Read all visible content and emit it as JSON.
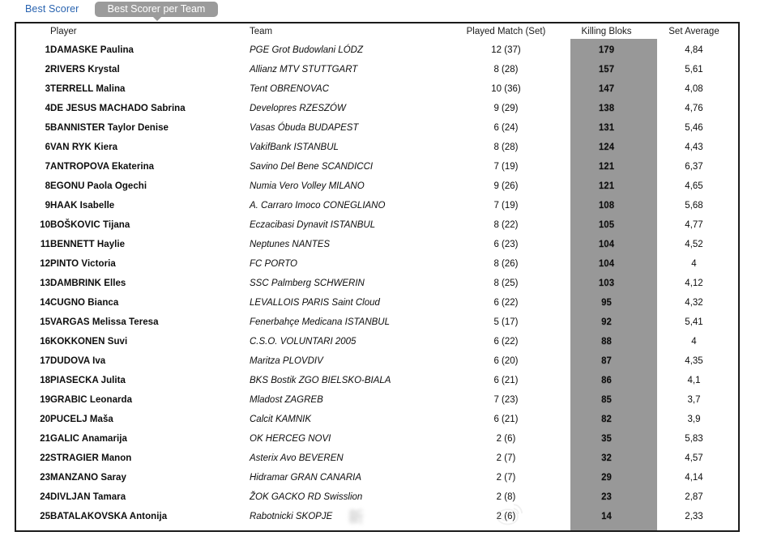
{
  "tabs": {
    "inactive_label": "Best Scorer",
    "active_label": "Best Scorer per Team"
  },
  "table": {
    "headers": {
      "rank": "",
      "player": "Player",
      "team": "Team",
      "played": "Played Match (Set)",
      "killing_blocks": "Killing Bloks",
      "set_average": "Set Average"
    },
    "highlight_color": "#989898",
    "rows": [
      {
        "rank": "1",
        "player": "DAMASKE Paulina",
        "team": "PGE Grot Budowlani LÓDZ",
        "played": "12 (37)",
        "kb": "179",
        "avg": "4,84"
      },
      {
        "rank": "2",
        "player": "RIVERS Krystal",
        "team": "Allianz MTV STUTTGART",
        "played": "8 (28)",
        "kb": "157",
        "avg": "5,61"
      },
      {
        "rank": "3",
        "player": "TERRELL Malina",
        "team": "Tent OBRENOVAC",
        "played": "10 (36)",
        "kb": "147",
        "avg": "4,08"
      },
      {
        "rank": "4",
        "player": "DE JESUS MACHADO Sabrina",
        "team": "Developres RZESZÓW",
        "played": "9 (29)",
        "kb": "138",
        "avg": "4,76"
      },
      {
        "rank": "5",
        "player": "BANNISTER Taylor Denise",
        "team": "Vasas Óbuda BUDAPEST",
        "played": "6 (24)",
        "kb": "131",
        "avg": "5,46"
      },
      {
        "rank": "6",
        "player": "VAN RYK Kiera",
        "team": "VakifBank ISTANBUL",
        "played": "8 (28)",
        "kb": "124",
        "avg": "4,43"
      },
      {
        "rank": "7",
        "player": "ANTROPOVA Ekaterina",
        "team": "Savino Del Bene SCANDICCI",
        "played": "7 (19)",
        "kb": "121",
        "avg": "6,37"
      },
      {
        "rank": "8",
        "player": "EGONU Paola Ogechi",
        "team": "Numia Vero Volley MILANO",
        "played": "9 (26)",
        "kb": "121",
        "avg": "4,65"
      },
      {
        "rank": "9",
        "player": "HAAK Isabelle",
        "team": "A. Carraro Imoco CONEGLIANO",
        "played": "7 (19)",
        "kb": "108",
        "avg": "5,68"
      },
      {
        "rank": "10",
        "player": "BOŠKOVIC Tijana",
        "team": "Eczacibasi Dynavit ISTANBUL",
        "played": "8 (22)",
        "kb": "105",
        "avg": "4,77"
      },
      {
        "rank": "11",
        "player": "BENNETT Haylie",
        "team": "Neptunes NANTES",
        "played": "6 (23)",
        "kb": "104",
        "avg": "4,52"
      },
      {
        "rank": "12",
        "player": "PINTO Victoria",
        "team": "FC PORTO",
        "played": "8 (26)",
        "kb": "104",
        "avg": "4"
      },
      {
        "rank": "13",
        "player": "DAMBRINK Elles",
        "team": "SSC Palmberg SCHWERIN",
        "played": "8 (25)",
        "kb": "103",
        "avg": "4,12"
      },
      {
        "rank": "14",
        "player": "CUGNO Bianca",
        "team": "LEVALLOIS PARIS Saint Cloud",
        "played": "6 (22)",
        "kb": "95",
        "avg": "4,32"
      },
      {
        "rank": "15",
        "player": "VARGAS Melissa Teresa",
        "team": "Fenerbahçe Medicana ISTANBUL",
        "played": "5 (17)",
        "kb": "92",
        "avg": "5,41"
      },
      {
        "rank": "16",
        "player": "KOKKONEN Suvi",
        "team": "C.S.O. VOLUNTARI 2005",
        "played": "6 (22)",
        "kb": "88",
        "avg": "4"
      },
      {
        "rank": "17",
        "player": "DUDOVA Iva",
        "team": "Maritza PLOVDIV",
        "played": "6 (20)",
        "kb": "87",
        "avg": "4,35"
      },
      {
        "rank": "18",
        "player": "PIASECKA Julita",
        "team": "BKS Bostik ZGO BIELSKO-BIALA",
        "played": "6 (21)",
        "kb": "86",
        "avg": "4,1"
      },
      {
        "rank": "19",
        "player": "GRABIC Leonarda",
        "team": "Mladost ZAGREB",
        "played": "7 (23)",
        "kb": "85",
        "avg": "3,7"
      },
      {
        "rank": "20",
        "player": "PUCELJ Maša",
        "team": "Calcit KAMNIK",
        "played": "6 (21)",
        "kb": "82",
        "avg": "3,9"
      },
      {
        "rank": "21",
        "player": "GALIC Anamarija",
        "team": "OK HERCEG NOVI",
        "played": "2 (6)",
        "kb": "35",
        "avg": "5,83"
      },
      {
        "rank": "22",
        "player": "STRAGIER Manon",
        "team": "Asterix Avo BEVEREN",
        "played": "2 (7)",
        "kb": "32",
        "avg": "4,57"
      },
      {
        "rank": "23",
        "player": "MANZANO Saray",
        "team": "Hidramar GRAN CANARIA",
        "played": "2 (7)",
        "kb": "29",
        "avg": "4,14"
      },
      {
        "rank": "24",
        "player": "DIVLJAN Tamara",
        "team": "ŽOK GACKO RD Swisslion",
        "played": "2 (8)",
        "kb": "23",
        "avg": "2,87"
      },
      {
        "rank": "25",
        "player": "BATALAKOVSKA Antonija",
        "team": "Rabotnicki SKOPJE",
        "played": "2 (6)",
        "kb": "14",
        "avg": "2,33"
      }
    ]
  },
  "watermark": {
    "text": "新"
  }
}
